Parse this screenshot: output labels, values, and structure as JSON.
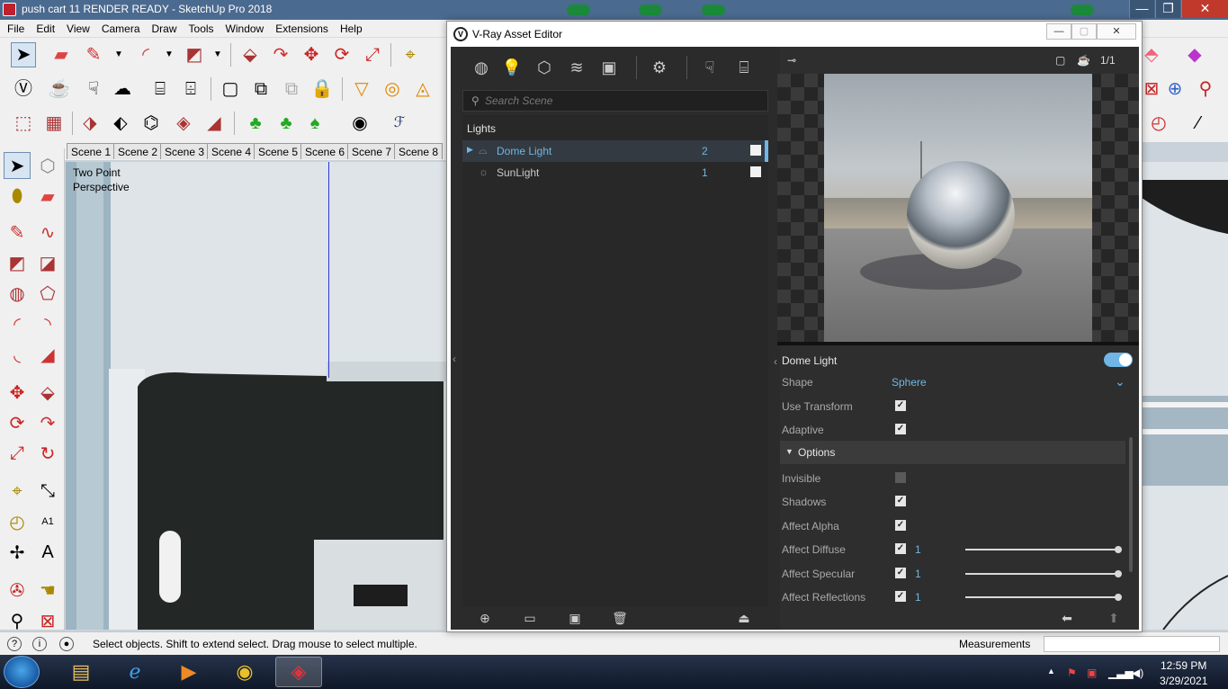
{
  "sketchup": {
    "window_title": "push cart 11 RENDER READY - SketchUp Pro 2018",
    "menu": [
      "File",
      "Edit",
      "View",
      "Camera",
      "Draw",
      "Tools",
      "Window",
      "Extensions",
      "Help"
    ],
    "scene_tabs": [
      "Scene 1",
      "Scene 2",
      "Scene 3",
      "Scene 4",
      "Scene 5",
      "Scene 6",
      "Scene 7",
      "Scene 8"
    ],
    "viewport_label": "Two Point Perspective",
    "status_text": "Select objects. Shift to extend select. Drag mouse to select multiple.",
    "measurements_label": "Measurements",
    "measurements_value": ""
  },
  "vray": {
    "title": "V-Ray Asset Editor",
    "search_placeholder": "Search Scene",
    "section": "Lights",
    "lights": [
      {
        "name": "Dome Light",
        "count": "2",
        "selected": true
      },
      {
        "name": "SunLight",
        "count": "1",
        "selected": false
      }
    ],
    "preview_ratio": "1/1",
    "properties": {
      "header": "Dome Light",
      "shape_label": "Shape",
      "shape_value": "Sphere",
      "use_transform_label": "Use Transform",
      "adaptive_label": "Adaptive",
      "options_label": "Options",
      "invisible_label": "Invisible",
      "shadows_label": "Shadows",
      "affect_alpha_label": "Affect Alpha",
      "affect_diffuse_label": "Affect Diffuse",
      "affect_diffuse_value": "1",
      "affect_specular_label": "Affect Specular",
      "affect_specular_value": "1",
      "affect_reflections_label": "Affect Reflections",
      "affect_reflections_value": "1"
    }
  },
  "taskbar": {
    "time": "12:59 PM",
    "date": "3/29/2021"
  },
  "colors": {
    "vray_accent": "#6fb6e6",
    "vray_panel": "#2b2b2b",
    "titlebar": "#4b6a8f"
  }
}
